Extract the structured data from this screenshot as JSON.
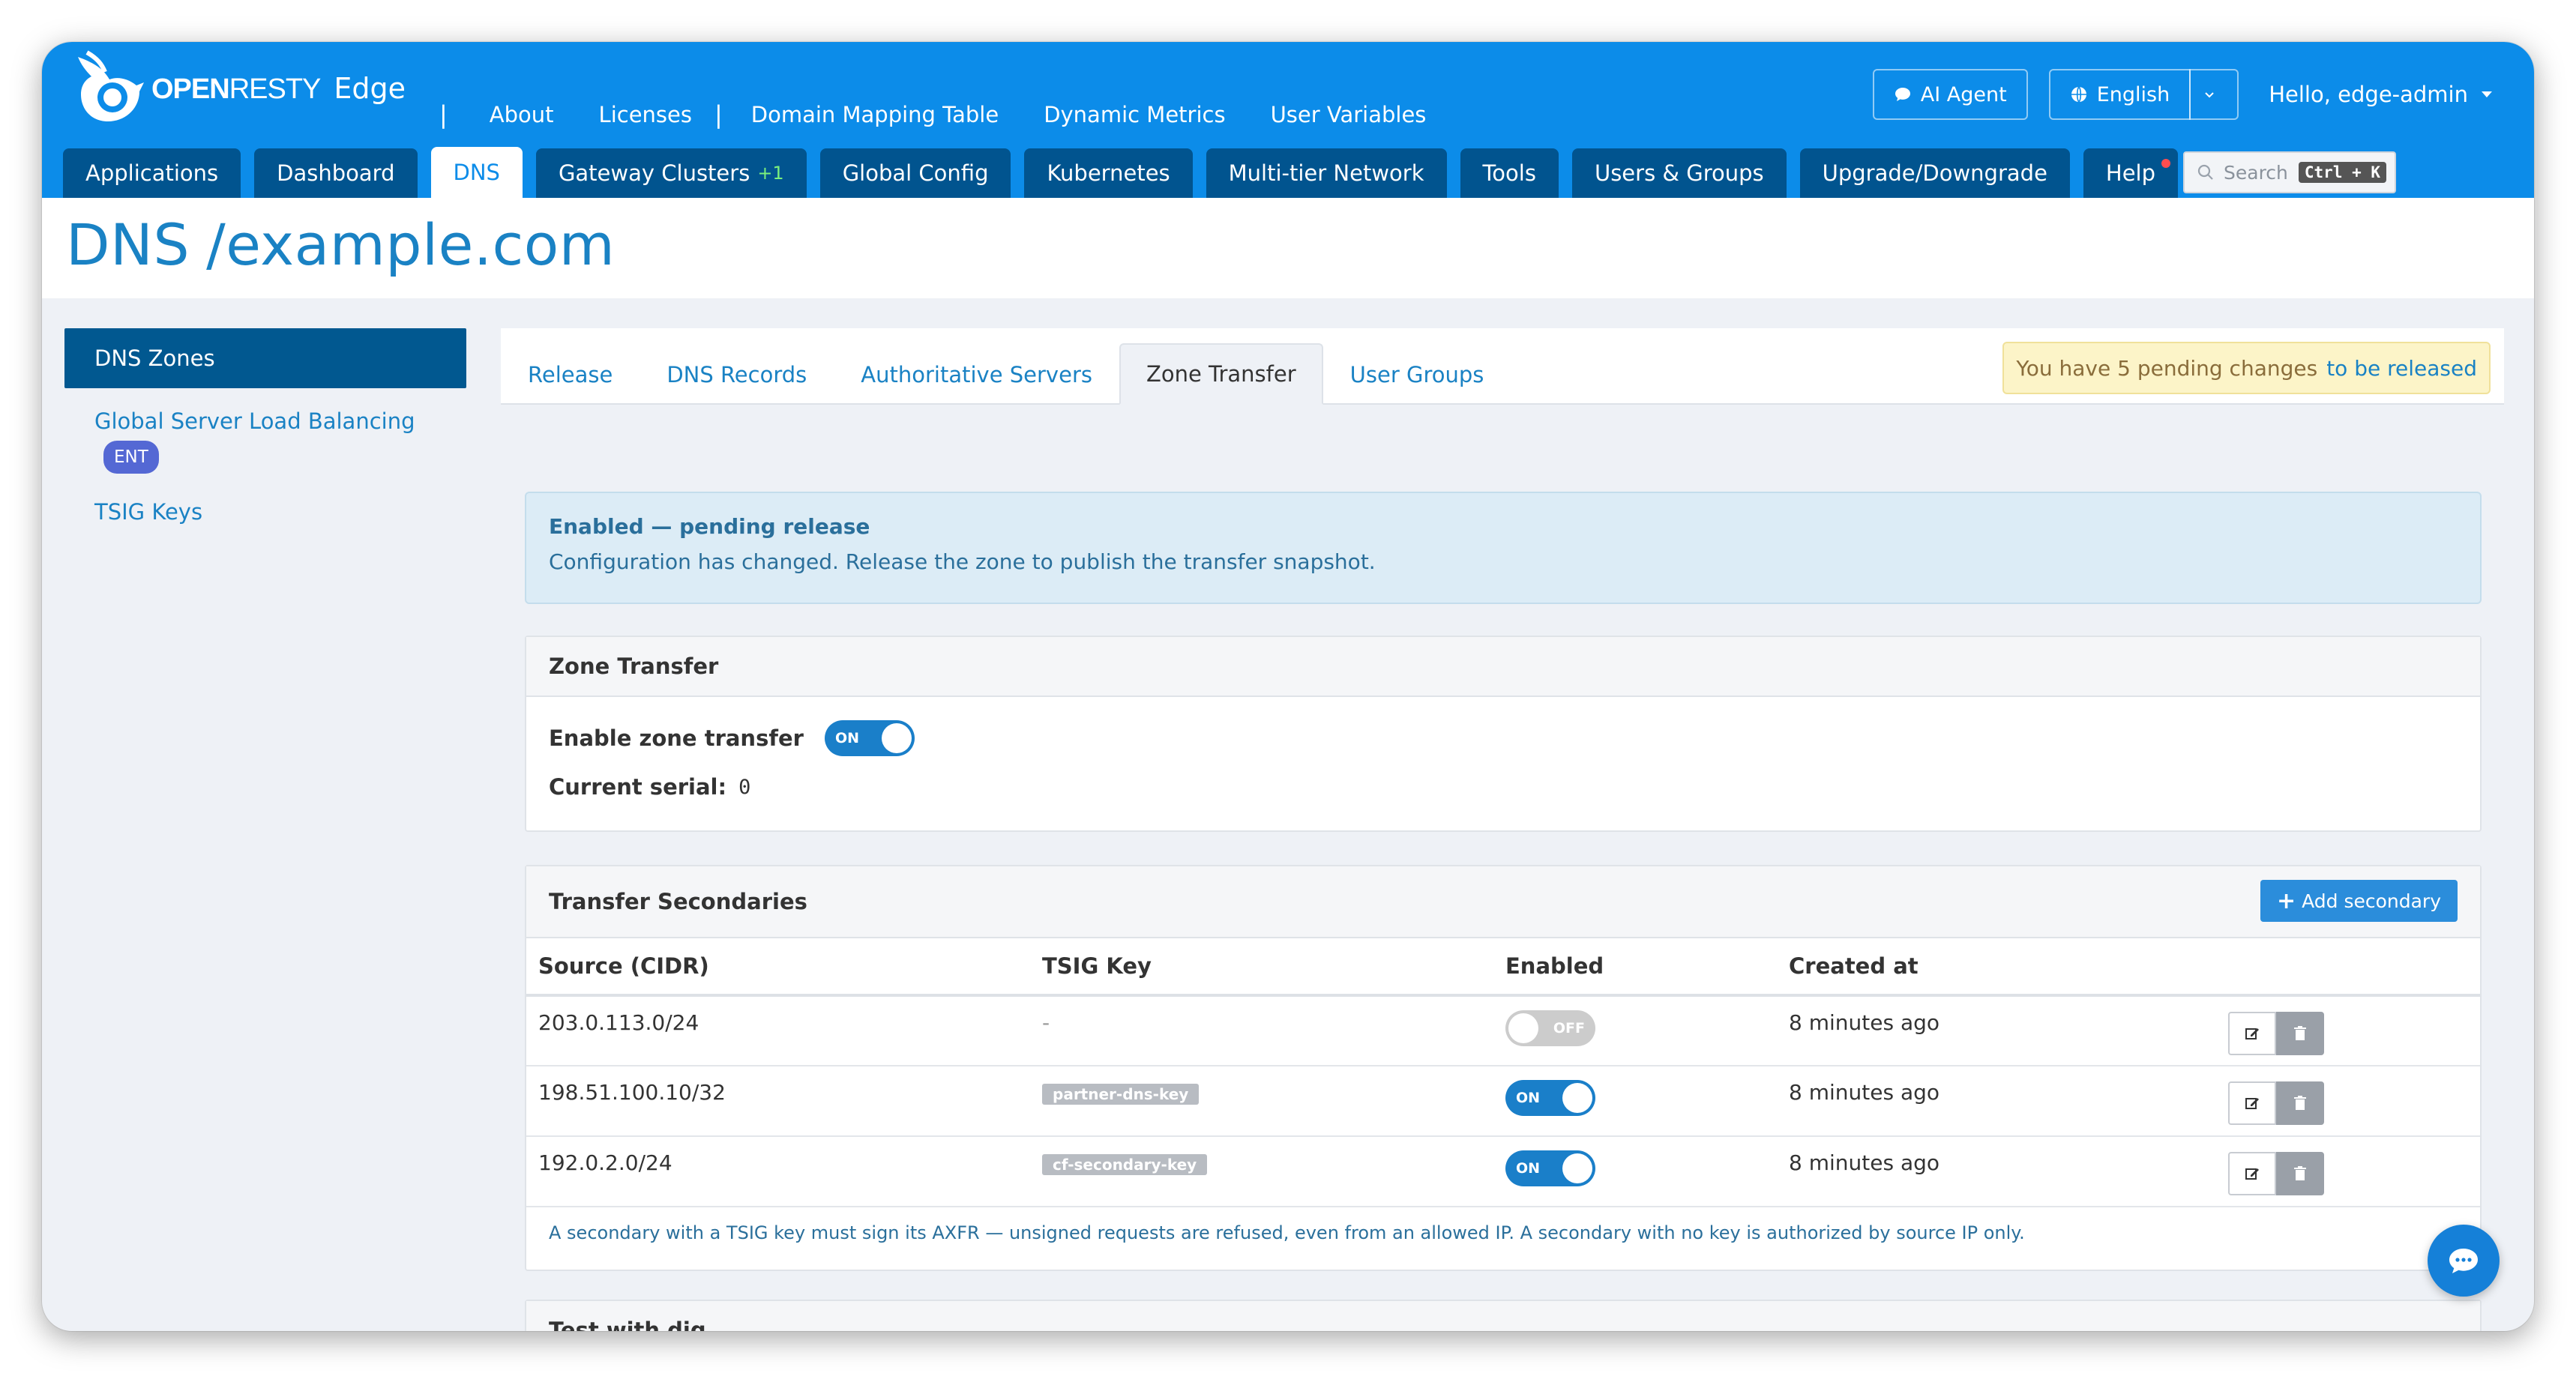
{
  "brand": {
    "open": "OPEN",
    "resty": "RESTY",
    "edge": "Edge"
  },
  "topnav": {
    "sep": "|",
    "links": [
      "About",
      "Licenses",
      "Domain Mapping Table",
      "Dynamic Metrics",
      "User Variables"
    ]
  },
  "top_right": {
    "ai_agent": "AI Agent",
    "language": "English",
    "greeting": "Hello, edge-admin"
  },
  "main_tabs": [
    {
      "label": "Applications"
    },
    {
      "label": "Dashboard"
    },
    {
      "label": "DNS",
      "active": true
    },
    {
      "label": "Gateway Clusters",
      "badge": "+1"
    },
    {
      "label": "Global Config"
    },
    {
      "label": "Kubernetes"
    },
    {
      "label": "Multi-tier Network"
    },
    {
      "label": "Tools"
    },
    {
      "label": "Users & Groups"
    },
    {
      "label": "Upgrade/Downgrade"
    },
    {
      "label": "Help"
    }
  ],
  "search": {
    "placeholder": "Search",
    "shortcut": "Ctrl + K"
  },
  "page": {
    "section": "DNS",
    "zone": "/example.com"
  },
  "sidebar": {
    "active": "DNS Zones",
    "gslb": "Global Server Load Balancing",
    "gslb_badge": "ENT",
    "tsig": "TSIG Keys"
  },
  "sub_tabs": [
    "Release",
    "DNS Records",
    "Authoritative Servers",
    "Zone Transfer",
    "User Groups"
  ],
  "pending": {
    "text": "You have 5 pending changes",
    "link": "to be released"
  },
  "alert": {
    "title": "Enabled — pending release",
    "message": "Configuration has changed. Release the zone to publish the transfer snapshot."
  },
  "zone_transfer": {
    "heading": "Zone Transfer",
    "enable_label": "Enable zone transfer",
    "toggle_on": "ON",
    "serial_label": "Current serial:",
    "serial_value": "0"
  },
  "secondaries": {
    "heading": "Transfer Secondaries",
    "add_button": "Add secondary",
    "columns": [
      "Source (CIDR)",
      "TSIG Key",
      "Enabled",
      "Created at"
    ],
    "rows": [
      {
        "source": "203.0.113.0/24",
        "tsig": "-",
        "enabled": "OFF",
        "created": "8 minutes ago"
      },
      {
        "source": "198.51.100.10/32",
        "tsig": "partner-dns-key",
        "enabled": "ON",
        "created": "8 minutes ago"
      },
      {
        "source": "192.0.2.0/24",
        "tsig": "cf-secondary-key",
        "enabled": "ON",
        "created": "8 minutes ago"
      }
    ],
    "note": "A secondary with a TSIG key must sign its AXFR — unsigned requests are refused, even from an allowed IP. A secondary with no key is authorized by source IP only."
  },
  "dig": {
    "heading": "Test with dig"
  },
  "colors": {
    "primary": "#0c8ce9",
    "dark_tab": "#01548f",
    "link": "#1a82c4",
    "toggle_on": "#1a7fc9"
  }
}
